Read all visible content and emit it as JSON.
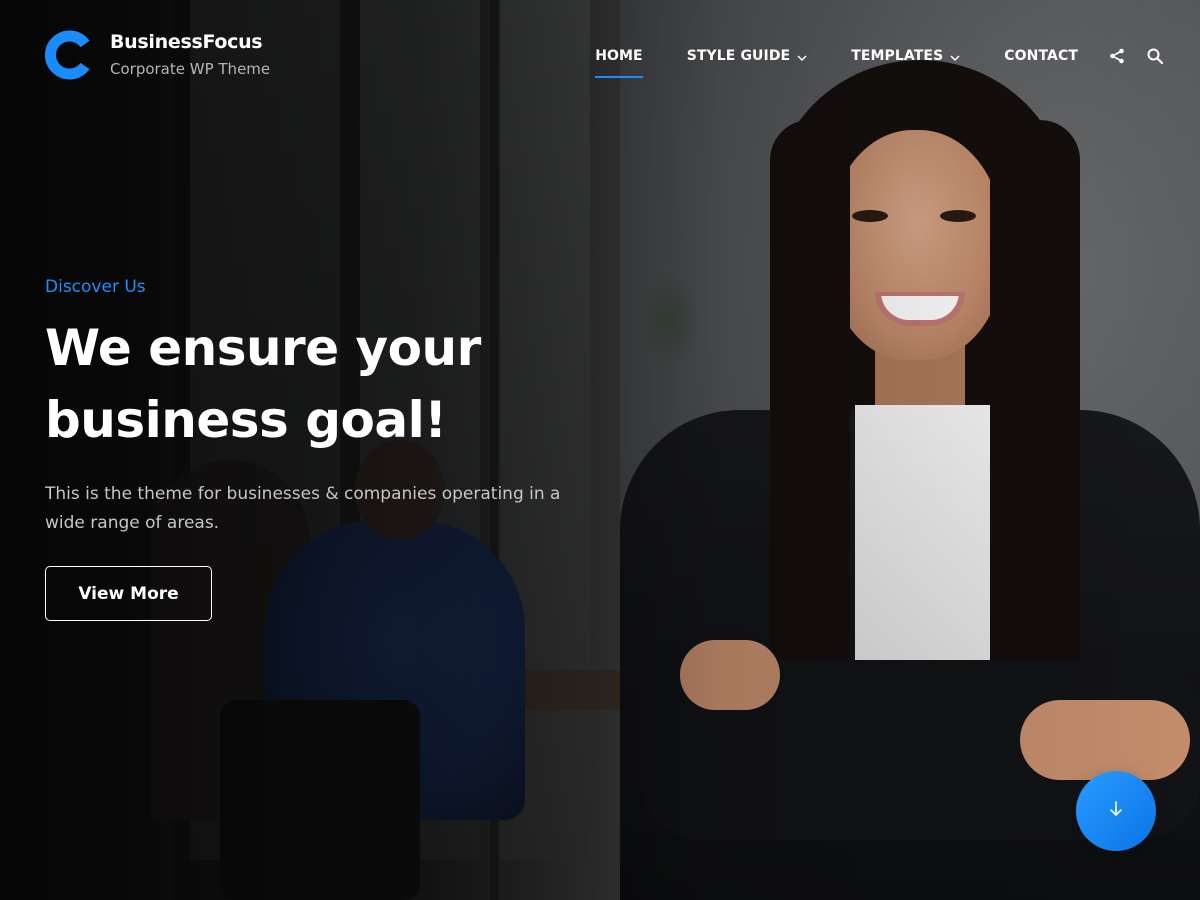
{
  "brand": {
    "title": "BusinessFocus",
    "tagline": "Corporate WP Theme",
    "accent_color": "#1a8cff",
    "logo_icon": "c-logo-icon"
  },
  "nav": {
    "items": [
      {
        "label": "HOME",
        "active": true,
        "dropdown": false
      },
      {
        "label": "STYLE GUIDE",
        "active": false,
        "dropdown": true
      },
      {
        "label": "TEMPLATES",
        "active": false,
        "dropdown": true
      },
      {
        "label": "CONTACT",
        "active": false,
        "dropdown": false
      }
    ],
    "share_icon": "share-icon",
    "search_icon": "search-icon"
  },
  "hero": {
    "eyebrow": "Discover Us",
    "headline_line1": "We ensure your",
    "headline_line2": "business goal!",
    "subtext": "This is the theme for businesses & companies operating in a wide range of areas.",
    "cta_label": "View More",
    "scroll_icon": "arrow-down-icon"
  }
}
